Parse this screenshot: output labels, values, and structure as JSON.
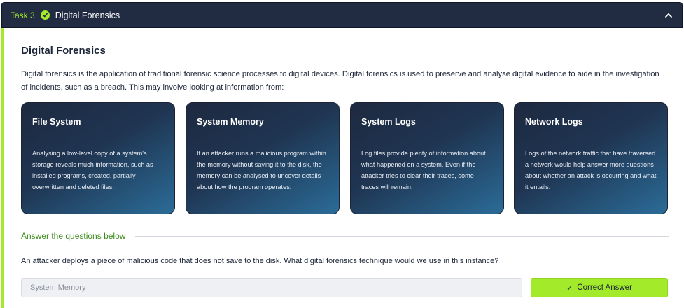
{
  "task": {
    "number": "Task 3",
    "title": "Digital Forensics",
    "completed": true,
    "accent_color": "#a3ea2a",
    "header_color": "#212c42"
  },
  "content": {
    "heading": "Digital Forensics",
    "intro": "Digital forensics is the application of traditional forensic science processes to digital devices. Digital forensics is used to preserve and analyse digital evidence to aide in the investigation of incidents, such as a breach. This may involve looking at information from:"
  },
  "cards": [
    {
      "title": "File System",
      "text": "Analysing a low-level copy of a system's storage reveals much information, such as installed programs, created, partially overwritten and deleted files."
    },
    {
      "title": "System Memory",
      "text": "If an attacker runs a malicious program within the memory without saving it to the disk, the memory can be analysed to uncover details about how the program operates."
    },
    {
      "title": "System Logs",
      "text": "Log files provide plenty of information about what happened on a system. Even if the attacker tries to clear their traces, some traces will remain."
    },
    {
      "title": "Network Logs",
      "text": "Logs of the network traffic that have traversed a network would help answer more questions about whether an attack is occurring and what it entails."
    }
  ],
  "questions": {
    "section_label": "Answer the questions below",
    "q1": {
      "text": "An attacker deploys a piece of malicious code that does not save to the disk. What digital forensics technique would we use in this instance?",
      "answer_value": "System Memory",
      "button_label": "Correct Answer",
      "button_icon": "check-icon"
    }
  }
}
